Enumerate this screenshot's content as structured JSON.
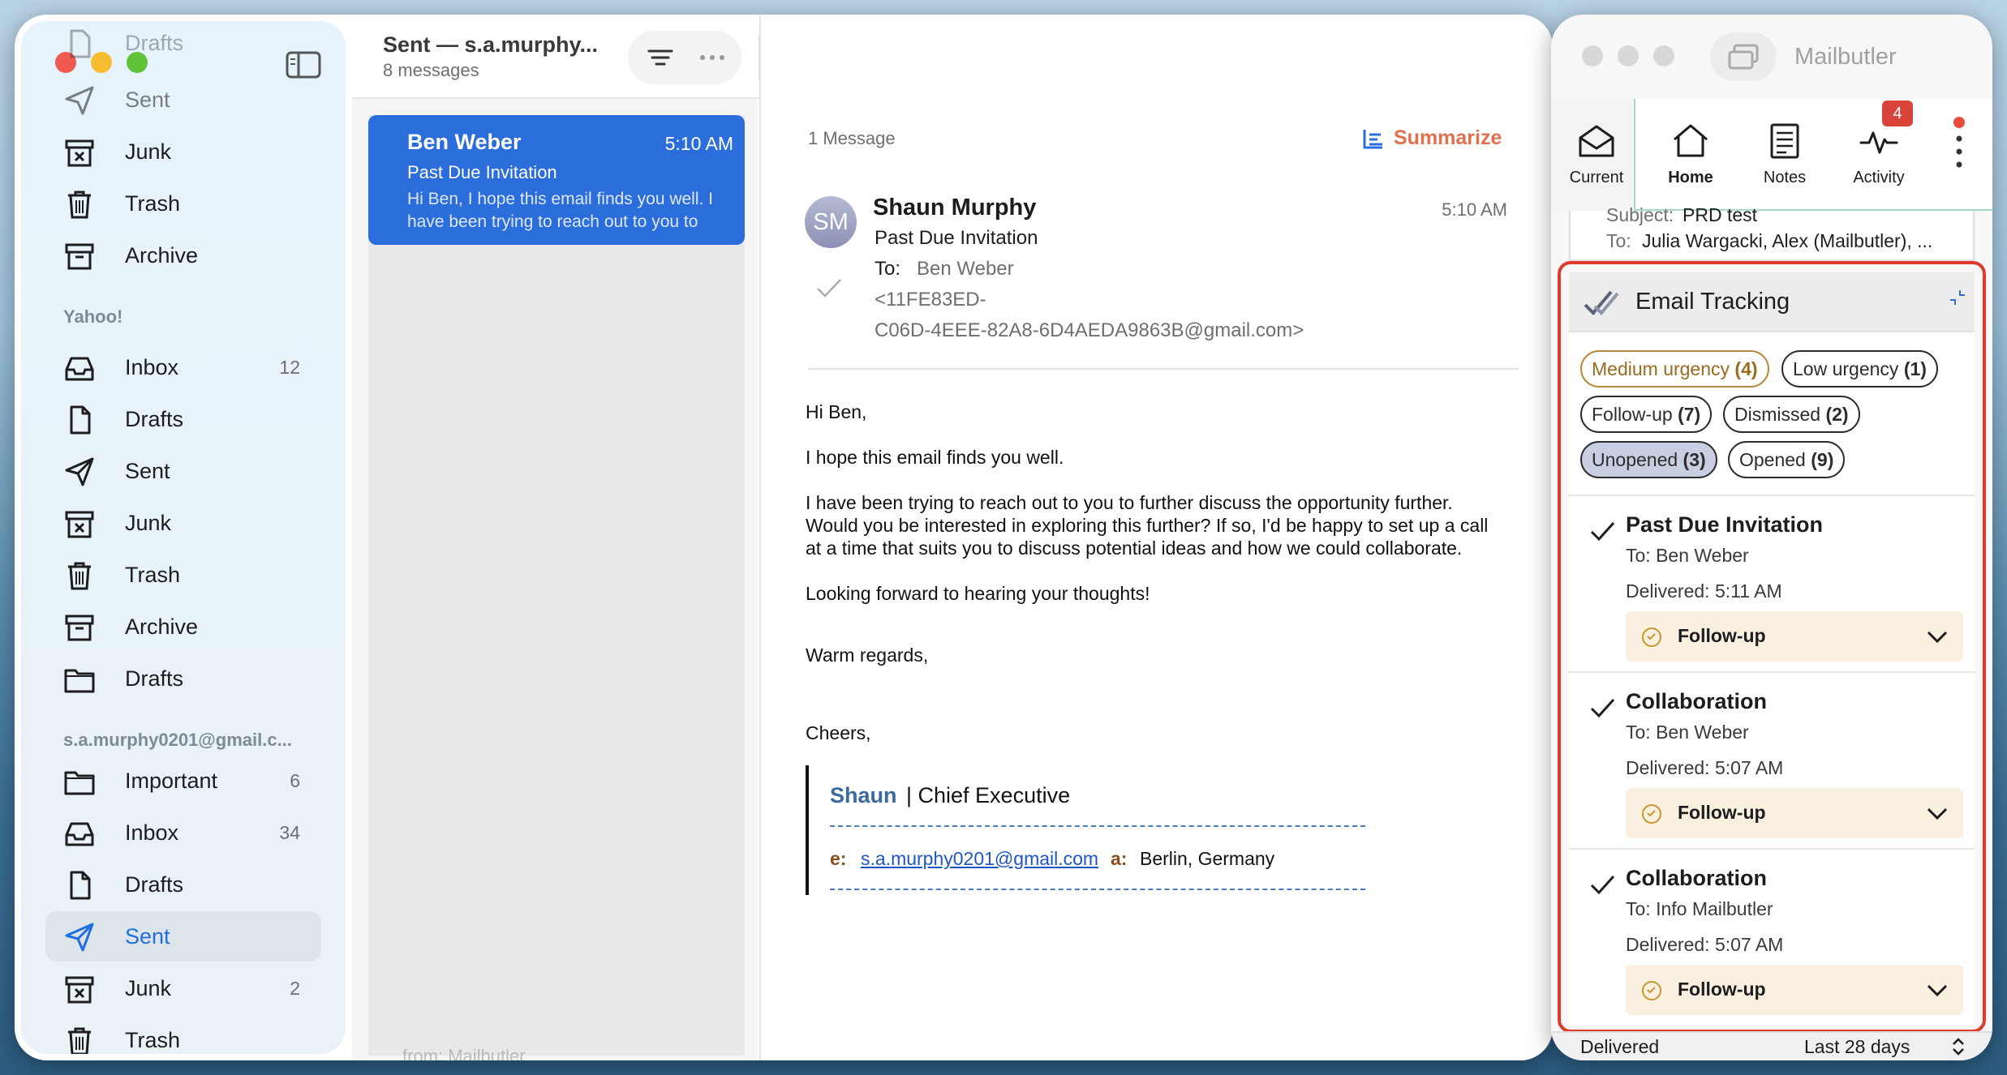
{
  "colors": {
    "accent": "#2d6fdc",
    "selected_message_bg": "#2c6ddc",
    "summarize": "#e2704c",
    "highlight_border": "#e03a2e",
    "flag": "#f08f1c",
    "followup_bg": "#f9f0e0"
  },
  "sidebar": {
    "top_items": [
      {
        "label": "Drafts",
        "icon": "doc-icon"
      },
      {
        "label": "Sent",
        "icon": "paper-plane-icon"
      },
      {
        "label": "Junk",
        "icon": "junk-bin-icon"
      },
      {
        "label": "Trash",
        "icon": "trash-icon"
      },
      {
        "label": "Archive",
        "icon": "archive-box-icon"
      }
    ],
    "yahoo": {
      "header": "Yahoo!",
      "items": [
        {
          "label": "Inbox",
          "count": "12",
          "icon": "inbox-tray-icon"
        },
        {
          "label": "Drafts",
          "count": "",
          "icon": "doc-icon"
        },
        {
          "label": "Sent",
          "count": "",
          "icon": "paper-plane-icon"
        },
        {
          "label": "Junk",
          "count": "",
          "icon": "junk-bin-icon"
        },
        {
          "label": "Trash",
          "count": "",
          "icon": "trash-icon"
        },
        {
          "label": "Archive",
          "count": "",
          "icon": "archive-box-icon"
        },
        {
          "label": "Drafts",
          "count": "",
          "icon": "folder-icon"
        }
      ]
    },
    "gmail": {
      "header": "s.a.murphy0201@gmail.c...",
      "items": [
        {
          "label": "Important",
          "count": "6",
          "icon": "folder-icon"
        },
        {
          "label": "Inbox",
          "count": "34",
          "icon": "inbox-tray-icon"
        },
        {
          "label": "Drafts",
          "count": "",
          "icon": "doc-icon"
        },
        {
          "label": "Sent",
          "count": "",
          "icon": "paper-plane-icon"
        },
        {
          "label": "Junk",
          "count": "2",
          "icon": "junk-bin-icon"
        },
        {
          "label": "Trash",
          "count": "",
          "icon": "trash-icon"
        }
      ]
    }
  },
  "toolbar": {
    "mailbox_title": "Sent — s.a.murphy...",
    "message_count": "8 messages"
  },
  "message_list": {
    "selected": {
      "sender": "Ben Weber",
      "time": "5:10 AM",
      "subject": "Past Due Invitation",
      "preview": "Hi Ben, I hope this email finds you well. I have been trying to reach out to you to further discuss the opportunity"
    }
  },
  "reading": {
    "thread_count": "1 Message",
    "summarize_label": "Summarize",
    "avatar_initials": "SM",
    "from_name": "Shaun Murphy",
    "time": "5:10 AM",
    "subject": "Past Due Invitation",
    "to_label": "To:",
    "to_name": "Ben Weber",
    "message_id_line1": "<11FE83ED-",
    "message_id_line2": "C06D-4EEE-82A8-6D4AEDA9863B@gmail.com>",
    "body": {
      "greeting": "Hi Ben,",
      "p1": "I hope this email finds you well.",
      "p2_l1": "I have been trying to reach out to you to further discuss the opportunity further.",
      "p2_l2": "Would you be interested in exploring this further? If so, I'd be happy to set up a call",
      "p2_l3": "at a time that suits you to discuss potential ideas and how we could collaborate.",
      "p3": "Looking forward to hearing your thoughts!",
      "closing": "Warm regards,",
      "signoff": "Cheers,"
    },
    "signature": {
      "name": "Shaun",
      "title": "| Chief Executive",
      "email_label": "e:",
      "email": "s.a.murphy0201@gmail.com",
      "address_label": "a:",
      "address": "Berlin, Germany"
    },
    "bottom_cut_text": "from: Mailbutler"
  },
  "mailbutler": {
    "title": "Mailbutler",
    "tabs": [
      {
        "label": "Current",
        "icon": "envelope-open-icon"
      },
      {
        "label": "Home",
        "icon": "home-icon"
      },
      {
        "label": "Notes",
        "icon": "notes-icon"
      },
      {
        "label": "Activity",
        "icon": "activity-pulse-icon",
        "badge": "4"
      }
    ],
    "prev_card": {
      "subject_label": "Subject:",
      "subject": "PRD test",
      "to_label": "To:",
      "to": "Julia Wargacki, Alex (Mailbutler), ..."
    },
    "tracking": {
      "title": "Email Tracking",
      "chips": [
        {
          "label": "Medium urgency",
          "count": "(4)"
        },
        {
          "label": "Low urgency",
          "count": "(1)"
        },
        {
          "label": "Follow-up",
          "count": "(7)"
        },
        {
          "label": "Dismissed",
          "count": "(2)"
        },
        {
          "label": "Unopened",
          "count": "(3)"
        },
        {
          "label": "Opened",
          "count": "(9)"
        }
      ],
      "items": [
        {
          "title": "Past Due Invitation",
          "to_label": "To:",
          "to": "Ben Weber",
          "delivered_label": "Delivered:",
          "delivered": "5:11 AM",
          "action": "Follow-up"
        },
        {
          "title": "Collaboration",
          "to_label": "To:",
          "to": "Ben Weber",
          "delivered_label": "Delivered:",
          "delivered": "5:07 AM",
          "action": "Follow-up"
        },
        {
          "title": "Collaboration",
          "to_label": "To:",
          "to": "Info Mailbutler",
          "delivered_label": "Delivered:",
          "delivered": "5:07 AM",
          "action": "Follow-up"
        }
      ]
    },
    "footer": {
      "status": "Delivered",
      "range": "Last 28 days"
    }
  }
}
